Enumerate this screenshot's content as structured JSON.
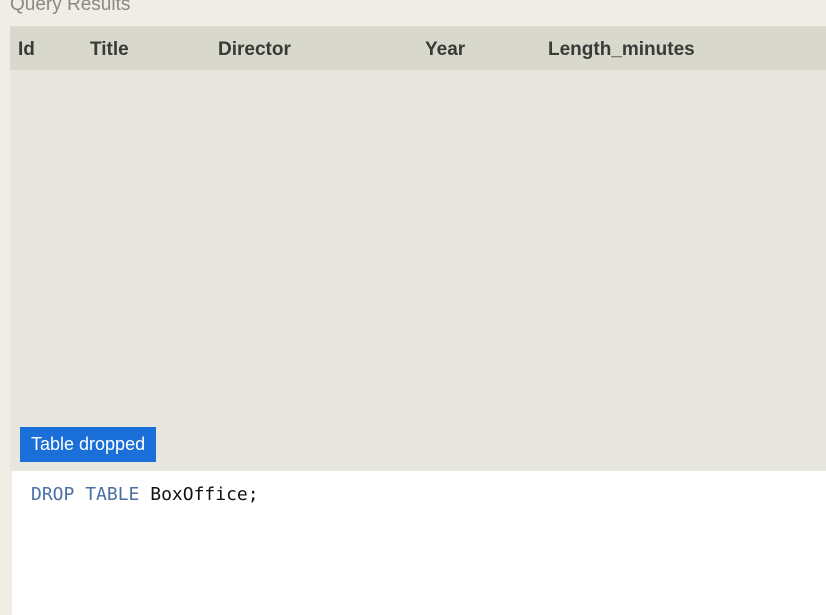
{
  "section": {
    "title": "Query Results"
  },
  "results": {
    "columns": [
      "Id",
      "Title",
      "Director",
      "Year",
      "Length_minutes"
    ],
    "rows": []
  },
  "status": {
    "message": "Table dropped",
    "color": "#1a6fd9"
  },
  "editor": {
    "keyword_drop": "DROP",
    "keyword_table": "TABLE",
    "table_name": "BoxOffice",
    "terminator": ";",
    "keyword_color": "#4a6fa5"
  }
}
